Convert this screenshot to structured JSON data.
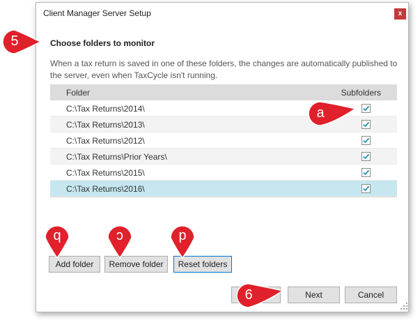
{
  "window": {
    "title": "Client Manager Server Setup",
    "close_glyph": "x"
  },
  "page": {
    "heading": "Choose folders to monitor",
    "description": "When a tax return is saved in one of these folders, the changes are automatically published to the server, even when TaxCycle isn't running."
  },
  "grid": {
    "col_folder": "Folder",
    "col_subfolders": "Subfolders",
    "rows": [
      {
        "path": "C:\\Tax Returns\\2014\\",
        "subfolders": true
      },
      {
        "path": "C:\\Tax Returns\\2013\\",
        "subfolders": true
      },
      {
        "path": "C:\\Tax Returns\\2012\\",
        "subfolders": true
      },
      {
        "path": "C:\\Tax Returns\\Prior Years\\",
        "subfolders": true
      },
      {
        "path": "C:\\Tax Returns\\2015\\",
        "subfolders": true
      },
      {
        "path": "C:\\Tax Returns\\2016\\",
        "subfolders": true
      }
    ],
    "selected_index": 5
  },
  "buttons": {
    "add_folder": "Add folder",
    "remove_folder": "Remove folder",
    "reset_folders": "Reset folders",
    "next": "Next",
    "cancel": "Cancel"
  },
  "callouts": {
    "step5": "5",
    "a": "a",
    "b": "b",
    "c": "c",
    "d": "d",
    "step6": "6"
  },
  "colors": {
    "callout_red": "#e0202a",
    "checkmark": "#2b8fb8",
    "selected_row": "#c6e7ef",
    "close_button": "#c6383b"
  }
}
